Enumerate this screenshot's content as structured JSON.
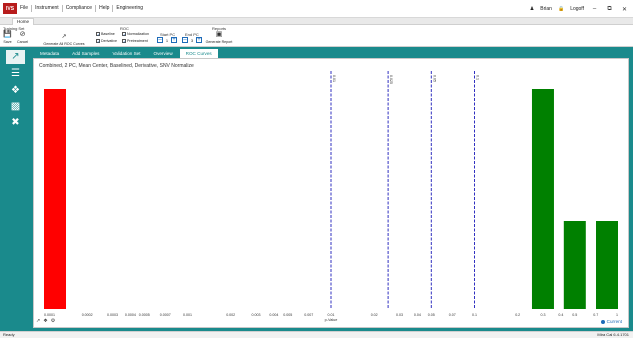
{
  "menubar": {
    "logo": "IVS",
    "items": [
      "File",
      "Instrument",
      "Compliance",
      "Help",
      "Engineering"
    ],
    "user": "Brian",
    "logoff": "Logoff"
  },
  "ribbon": {
    "tab": "Home",
    "training_set_label": "Training Set",
    "save_label": "Save",
    "cancel_label": "Cancel",
    "generate_all_label": "Generate All ROC Curves",
    "roc_label": "ROC",
    "baseline_label": "Baseline",
    "normalization_label": "Normalization",
    "derivative_label": "Derivative",
    "pretreatment_label": "Pretreatment",
    "start_pc_label": "Start PC",
    "start_pc_value": "1",
    "end_pc_label": "End PC",
    "end_pc_value": "3",
    "reports_label": "Reports",
    "generate_report_label": "Generate Report"
  },
  "subtabs": [
    "Metadata",
    "Add Samples",
    "Validation Set",
    "Overview",
    "ROC Curves"
  ],
  "active_subtab": "ROC Curves",
  "chart_data": {
    "type": "bar",
    "title": "Combined, 2 PC, Mean Center, Baselined, Derivative, SNV Normalize",
    "xlabel": "p-Value",
    "x_scale": "log",
    "xlim": [
      0.0001,
      1
    ],
    "tick_labels": [
      "0.0001",
      "0.0002",
      "0.0003",
      "0.0004",
      "0.0005",
      "0.0007",
      "0.001",
      "0.002",
      "0.003",
      "0.004",
      "0.005",
      "0.007",
      "0.01",
      "0.02",
      "0.03",
      "0.04",
      "0.05",
      "0.07",
      "0.1",
      "0.2",
      "0.3",
      "0.4",
      "0.5",
      "0.7",
      "1"
    ],
    "tick_values": [
      0.0001,
      0.0002,
      0.0003,
      0.0004,
      0.0005,
      0.0007,
      0.001,
      0.002,
      0.003,
      0.004,
      0.005,
      0.007,
      0.01,
      0.02,
      0.03,
      0.04,
      0.05,
      0.07,
      0.1,
      0.2,
      0.3,
      0.4,
      0.5,
      0.7,
      1
    ],
    "bars": [
      {
        "x": 0.0001,
        "value": 1.0,
        "color": "#ff0000"
      },
      {
        "x": 0.3,
        "value": 1.0,
        "color": "#008000"
      },
      {
        "x": 0.5,
        "value": 0.4,
        "color": "#008000"
      },
      {
        "x": 0.85,
        "value": 0.4,
        "color": "#008000"
      }
    ],
    "vlines": [
      {
        "x": 0.01,
        "label": "0.01"
      },
      {
        "x": 0.025,
        "label": "0.025"
      },
      {
        "x": 0.05,
        "label": "0.05"
      },
      {
        "x": 0.1,
        "label": "0.1"
      }
    ],
    "legend": "Current",
    "legend_color": "#1e6bb8"
  },
  "colors": {
    "teal": "#1a8a8c",
    "red_bar": "#ff0000",
    "green_bar": "#008000",
    "vline": "#3030c0"
  },
  "status": {
    "left": "Ready",
    "version": "Mira Cal 6.4.1701"
  }
}
